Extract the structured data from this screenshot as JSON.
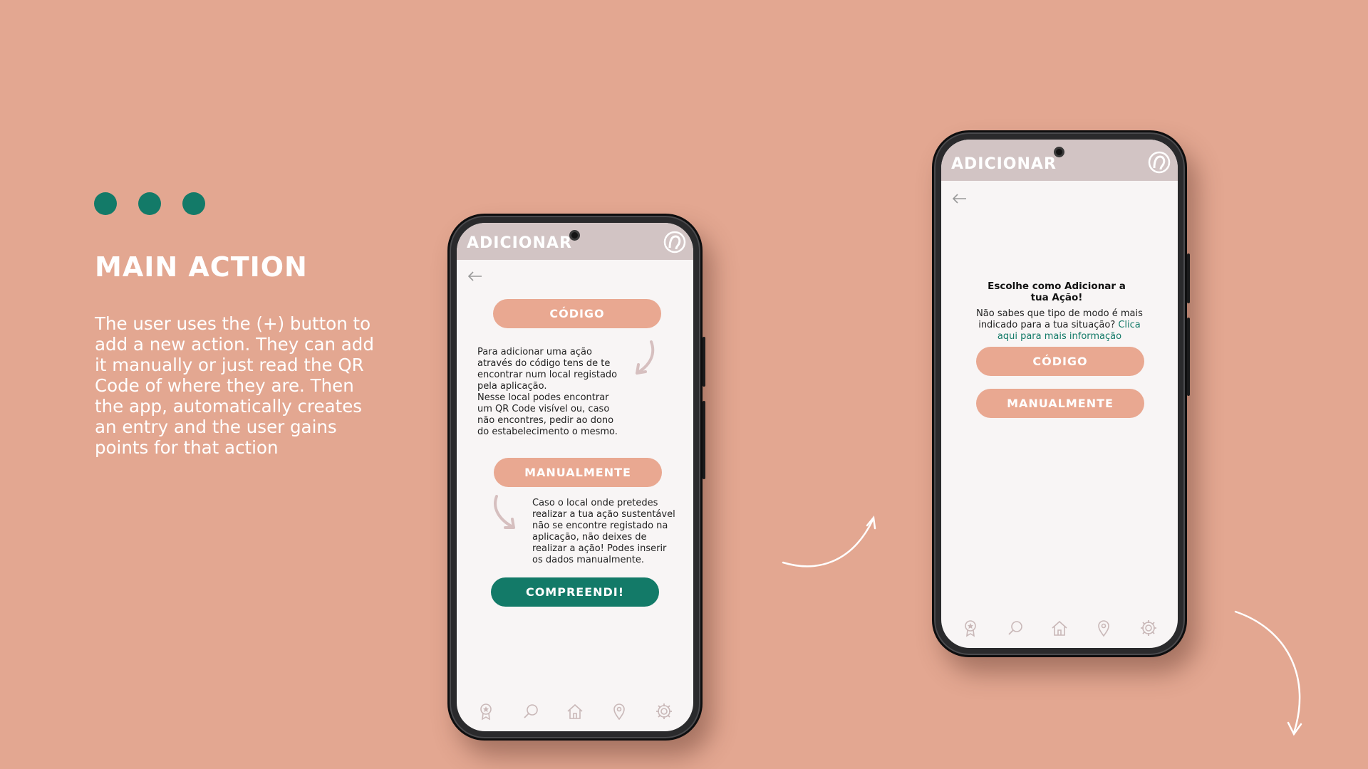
{
  "slide": {
    "title": "MAIN ACTION",
    "description": "The user uses the (+) button to add a new action. They can add it manually or just read the QR Code of where they are. Then the app, automatically creates an entry and the user gains points for that action"
  },
  "colors": {
    "background": "#e3a791",
    "accent": "#137a68",
    "pill": "#e9a891",
    "header": "#d2c4c4"
  },
  "phone1": {
    "header_title": "ADICIONAR",
    "codigo_label": "CÓDIGO",
    "codigo_text_lines": [
      "Para adicionar uma ação",
      "através do código tens de te",
      "encontrar num local registado",
      "pela aplicação.",
      "Nesse local podes encontrar",
      "um QR Code visível ou, caso",
      "não encontres, pedir ao dono",
      "do estabelecimento o mesmo."
    ],
    "manual_label": "MANUALMENTE",
    "manual_text_lines": [
      "Caso o local onde pretedes",
      "realizar a tua ação sustentável",
      "não se encontre registado na",
      "aplicação, não deixes de",
      "realizar a ação! Podes inserir",
      "os dados manualmente."
    ],
    "confirm_label": "COMPREENDI!"
  },
  "phone2": {
    "header_title": "ADICIONAR",
    "choose_title_lines": [
      "Escolhe como Adicionar a",
      "tua Ação!"
    ],
    "help_line1": "Não sabes que tipo de modo é mais",
    "help_line2": "indicado para a tua situação? ",
    "help_link_part1": "Clica",
    "help_link_part2": "aqui para mais informação",
    "codigo_label": "CÓDIGO",
    "manual_label": "MANUALMENTE"
  },
  "nav_icons": [
    "award-icon",
    "search-icon",
    "home-icon",
    "location-pin-icon",
    "settings-icon"
  ]
}
